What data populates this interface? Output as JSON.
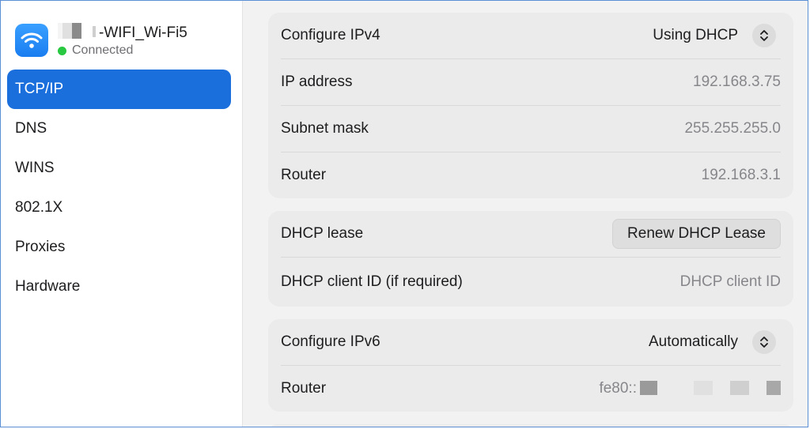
{
  "network": {
    "name": "-WIFI_Wi-Fi5",
    "status": "Connected",
    "status_color": "#28c840"
  },
  "sidebar": {
    "items": [
      {
        "label": "TCP/IP",
        "active": true
      },
      {
        "label": "DNS"
      },
      {
        "label": "WINS"
      },
      {
        "label": "802.1X"
      },
      {
        "label": "Proxies"
      },
      {
        "label": "Hardware"
      }
    ]
  },
  "ipv4": {
    "configure_label": "Configure IPv4",
    "configure_value": "Using DHCP",
    "ip_label": "IP address",
    "ip_value": "192.168.3.75",
    "subnet_label": "Subnet mask",
    "subnet_value": "255.255.255.0",
    "router_label": "Router",
    "router_value": "192.168.3.1"
  },
  "dhcp": {
    "lease_label": "DHCP lease",
    "renew_button": "Renew DHCP Lease",
    "client_id_label": "DHCP client ID (if required)",
    "client_id_placeholder": "DHCP client ID"
  },
  "ipv6": {
    "configure_label": "Configure IPv6",
    "configure_value": "Automatically",
    "router_label": "Router",
    "router_value": "fe80::"
  },
  "colors": {
    "accent": "#1a6fdc",
    "wifi_icon": "#1a7df0"
  },
  "icons": {
    "network": "wifi-icon",
    "popup": "chevron-up-down-icon"
  }
}
